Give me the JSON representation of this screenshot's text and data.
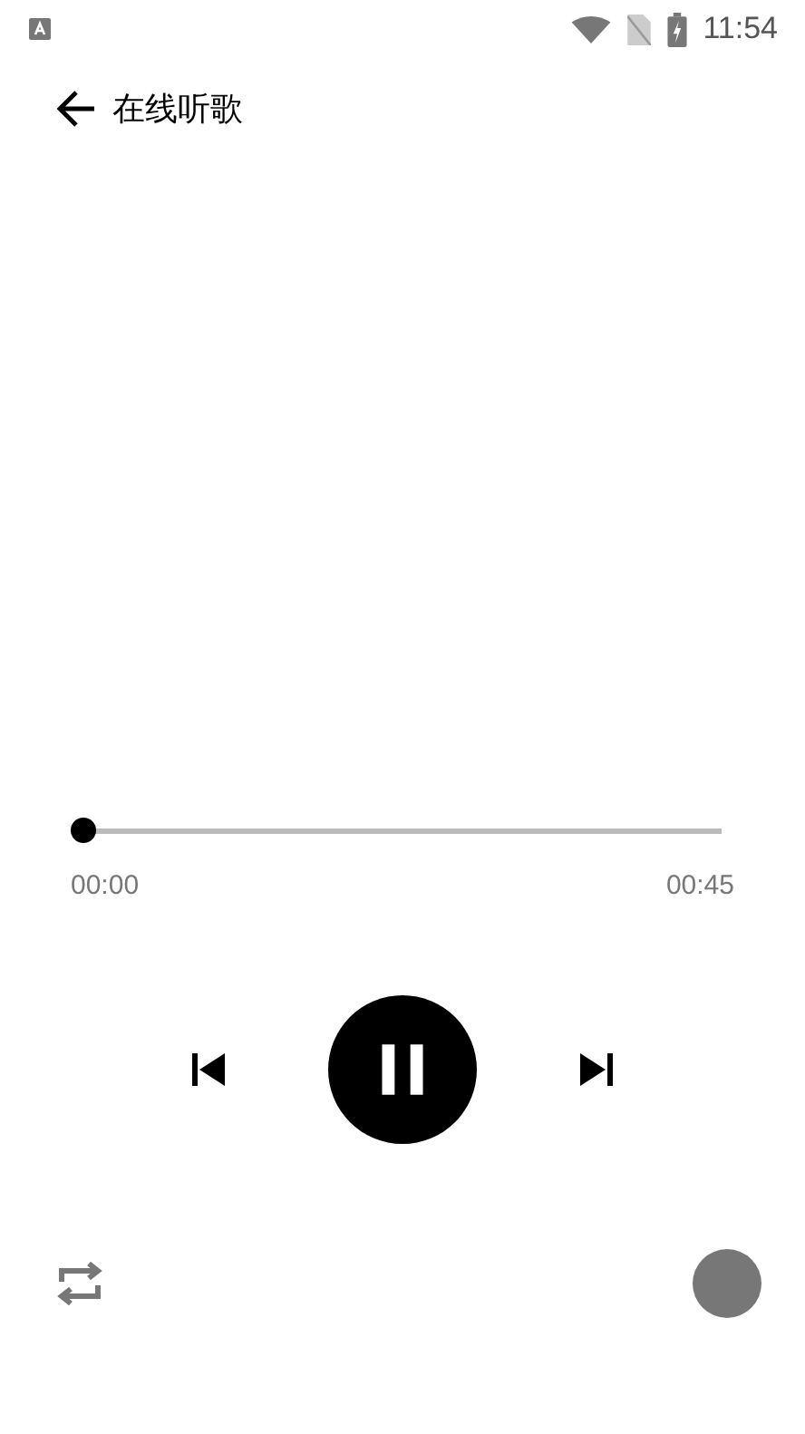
{
  "status_bar": {
    "time": "11:54"
  },
  "header": {
    "title": "在线听歌"
  },
  "player": {
    "level": 0,
    "elapsed": "00:00",
    "duration": "00:45",
    "playing": true
  }
}
